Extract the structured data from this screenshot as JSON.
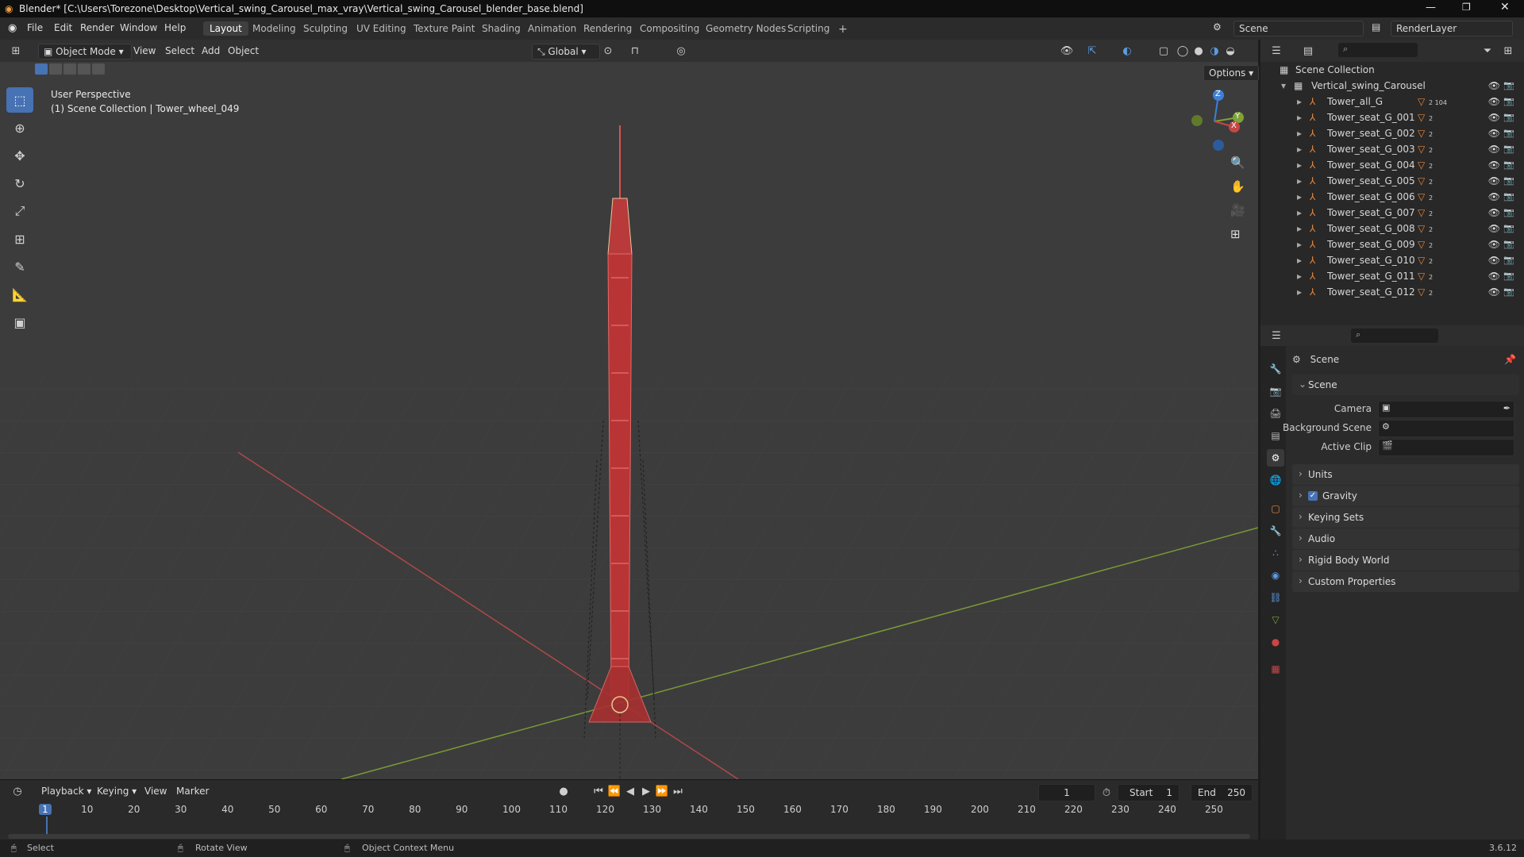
{
  "window": {
    "title": "Blender* [C:\\Users\\Torezone\\Desktop\\Vertical_swing_Carousel_max_vray\\Vertical_swing_Carousel_blender_base.blend]"
  },
  "menu": {
    "items": [
      "File",
      "Edit",
      "Render",
      "Window",
      "Help"
    ]
  },
  "workspaces": {
    "tabs": [
      "Layout",
      "Modeling",
      "Sculpting",
      "UV Editing",
      "Texture Paint",
      "Shading",
      "Animation",
      "Rendering",
      "Compositing",
      "Geometry Nodes",
      "Scripting"
    ],
    "active": "Layout",
    "add": "+"
  },
  "scene_selector": {
    "value": "Scene"
  },
  "renderlayer_selector": {
    "value": "RenderLayer"
  },
  "viewport_header": {
    "mode": "Object Mode",
    "menus": [
      "View",
      "Select",
      "Add",
      "Object"
    ],
    "orientation": "Global",
    "options": "Options"
  },
  "viewport_info": {
    "line1": "User Perspective",
    "line2": "(1) Scene Collection | Tower_wheel_049"
  },
  "gizmo": {
    "z": "Z",
    "y": "Y",
    "x": "X"
  },
  "outliner": {
    "root": "Scene Collection",
    "collection": "Vertical_swing_Carousel",
    "items": [
      {
        "name": "Tower_all_G",
        "badge": "2 104"
      },
      {
        "name": "Tower_seat_G_001",
        "badge": "2"
      },
      {
        "name": "Tower_seat_G_002",
        "badge": "2"
      },
      {
        "name": "Tower_seat_G_003",
        "badge": "2"
      },
      {
        "name": "Tower_seat_G_004",
        "badge": "2"
      },
      {
        "name": "Tower_seat_G_005",
        "badge": "2"
      },
      {
        "name": "Tower_seat_G_006",
        "badge": "2"
      },
      {
        "name": "Tower_seat_G_007",
        "badge": "2"
      },
      {
        "name": "Tower_seat_G_008",
        "badge": "2"
      },
      {
        "name": "Tower_seat_G_009",
        "badge": "2"
      },
      {
        "name": "Tower_seat_G_010",
        "badge": "2"
      },
      {
        "name": "Tower_seat_G_011",
        "badge": "2"
      },
      {
        "name": "Tower_seat_G_012",
        "badge": "2"
      }
    ]
  },
  "properties": {
    "context": "Scene",
    "section": "Scene",
    "fields": [
      {
        "label": "Camera",
        "value": ""
      },
      {
        "label": "Background Scene",
        "value": ""
      },
      {
        "label": "Active Clip",
        "value": ""
      }
    ],
    "panels": [
      "Units",
      "Gravity",
      "Keying Sets",
      "Audio",
      "Rigid Body World",
      "Custom Properties"
    ],
    "gravity_checked": true
  },
  "timeline": {
    "menus": [
      "Playback",
      "Keying",
      "View",
      "Marker"
    ],
    "current_frame": "1",
    "start_label": "Start",
    "start": "1",
    "end_label": "End",
    "end": "250",
    "ticks": [
      "1",
      "10",
      "20",
      "30",
      "40",
      "50",
      "60",
      "70",
      "80",
      "90",
      "100",
      "110",
      "120",
      "130",
      "140",
      "150",
      "160",
      "170",
      "180",
      "190",
      "200",
      "210",
      "220",
      "230",
      "240",
      "250"
    ]
  },
  "status": {
    "select": "Select",
    "rotate": "Rotate View",
    "context_menu": "Object Context Menu",
    "version": "3.6.12"
  },
  "colors": {
    "accent": "#4772b3",
    "x_axis": "#c64646",
    "y_axis": "#7fa337",
    "z_axis": "#3d80d8",
    "object": "#e05050"
  }
}
